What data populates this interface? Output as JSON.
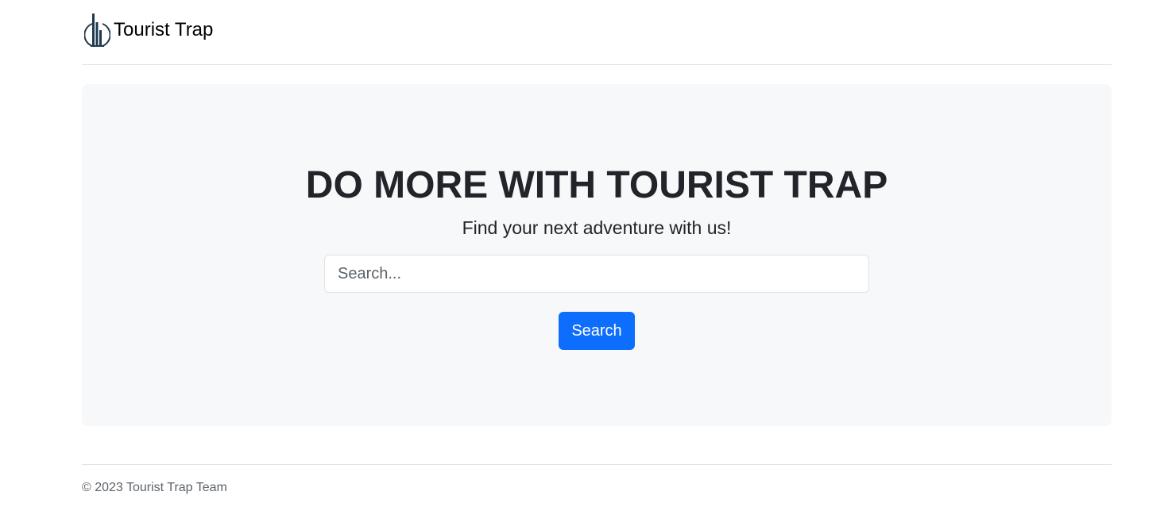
{
  "header": {
    "brand_name": "Tourist Trap",
    "logo_icon": "city-skyline-icon"
  },
  "hero": {
    "title": "DO MORE WITH TOURIST TRAP",
    "subtitle": "Find your next adventure with us!",
    "search": {
      "placeholder": "Search...",
      "value": ""
    },
    "search_button_label": "Search"
  },
  "footer": {
    "copyright": "© 2023 Tourist Trap Team"
  },
  "colors": {
    "primary": "#0d6efd",
    "hero_background": "#f7f8fa",
    "logo": "#1f3a4f",
    "text": "#212529",
    "muted_text": "#5c636a",
    "border": "#dee2e6"
  }
}
